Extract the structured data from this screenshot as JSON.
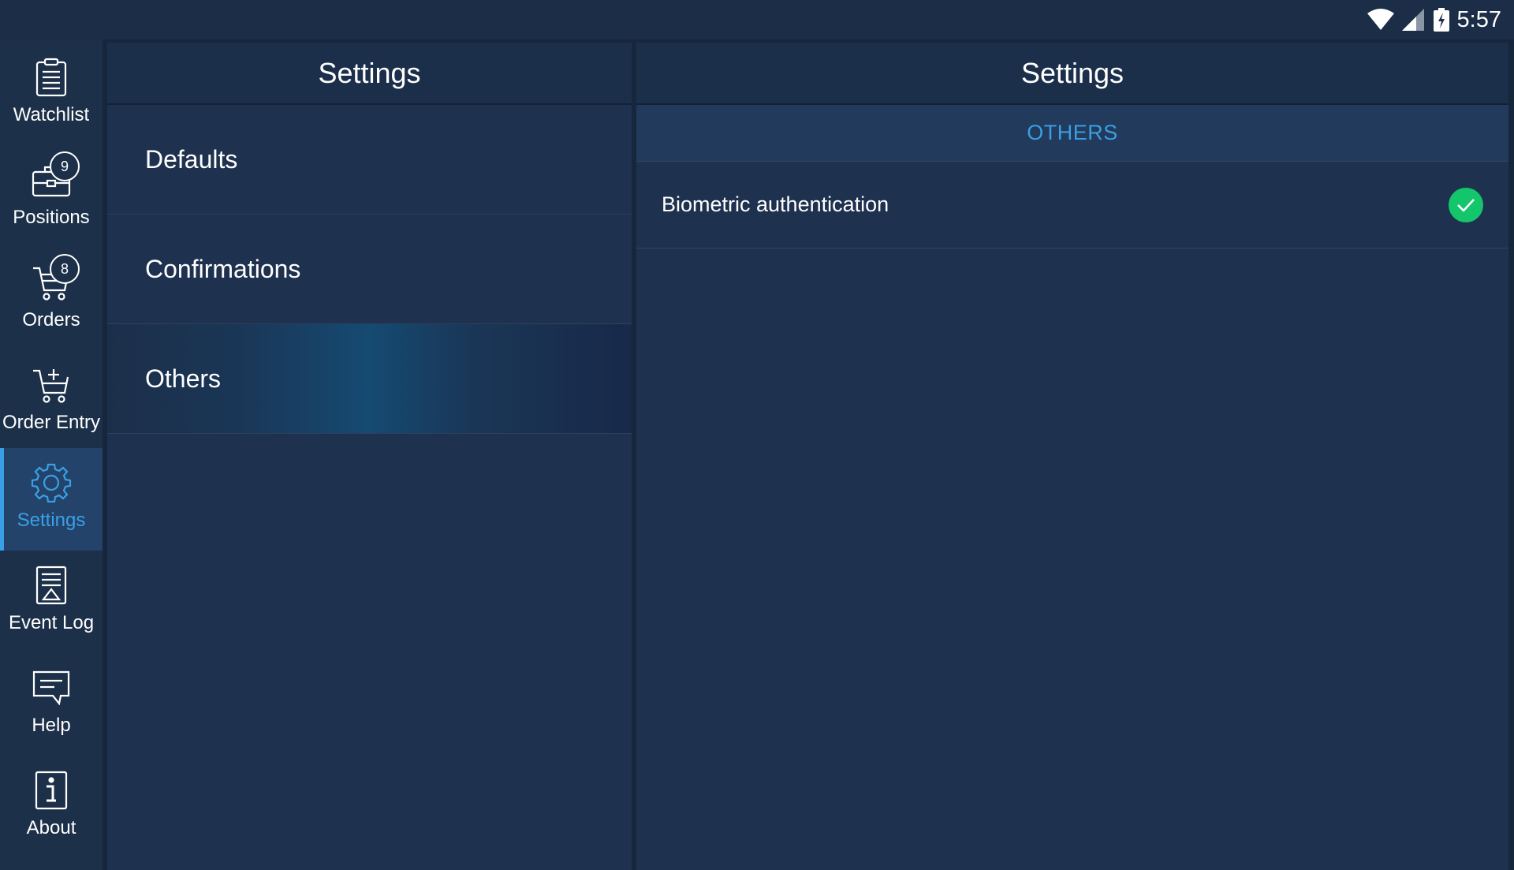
{
  "status_bar": {
    "time": "5:57",
    "icons": [
      "wifi-icon",
      "cell-signal-icon",
      "battery-charging-icon"
    ]
  },
  "nav": {
    "items": [
      {
        "label": "Watchlist",
        "icon": "clipboard-list-icon"
      },
      {
        "label": "Positions",
        "icon": "briefcase-icon",
        "badge": "9"
      },
      {
        "label": "Orders",
        "icon": "cart-icon",
        "badge": "8"
      },
      {
        "label": "Order Entry",
        "icon": "cart-plus-icon"
      },
      {
        "label": "Settings",
        "icon": "gear-icon",
        "active": true
      },
      {
        "label": "Event Log",
        "icon": "event-log-icon"
      },
      {
        "label": "Help",
        "icon": "chat-bubble-icon"
      },
      {
        "label": "About",
        "icon": "info-icon"
      }
    ]
  },
  "settings_menu": {
    "title": "Settings",
    "items": [
      {
        "label": "Defaults"
      },
      {
        "label": "Confirmations"
      },
      {
        "label": "Others",
        "selected": true
      }
    ]
  },
  "detail": {
    "title": "Settings",
    "section": "OTHERS",
    "rows": [
      {
        "label": "Biometric authentication",
        "enabled": true
      }
    ]
  },
  "colors": {
    "accent": "#3aa0e6",
    "check": "#13c56b",
    "background": "#1e314e"
  }
}
